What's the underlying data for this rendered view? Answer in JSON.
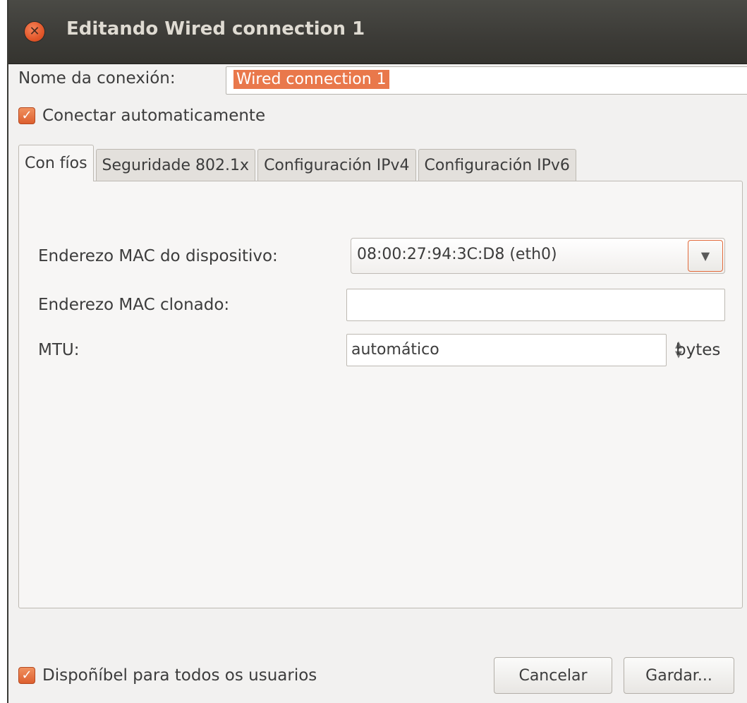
{
  "window": {
    "title": "Editando Wired connection 1"
  },
  "connection_name": {
    "label": "Nome da conexión:",
    "value": "Wired connection 1"
  },
  "auto_connect": {
    "label": "Conectar automaticamente",
    "checked": true
  },
  "tabs": [
    {
      "label": "Con fíos",
      "active": true
    },
    {
      "label": "Seguridade 802.1x",
      "active": false
    },
    {
      "label": "Configuración IPv4",
      "active": false
    },
    {
      "label": "Configuración IPv6",
      "active": false
    }
  ],
  "wired": {
    "device_mac": {
      "label": "Enderezo MAC do dispositivo:",
      "value": "08:00:27:94:3C:D8 (eth0)"
    },
    "cloned_mac": {
      "label": "Enderezo MAC clonado:",
      "value": ""
    },
    "mtu": {
      "label": "MTU:",
      "value": "automático",
      "unit": "bytes"
    }
  },
  "all_users": {
    "label": "Dispoñíbel para todos os usuarios",
    "checked": true
  },
  "buttons": {
    "cancel": "Cancelar",
    "save": "Gardar..."
  },
  "colors": {
    "accent": "#e2572a",
    "titlebar": "#3c3b37"
  }
}
